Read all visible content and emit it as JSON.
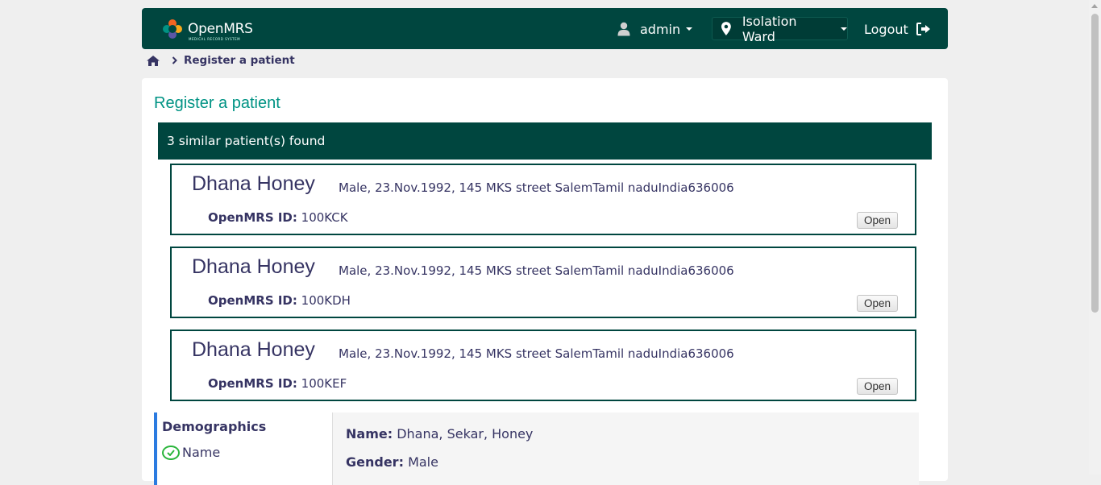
{
  "header": {
    "brand": "OpenMRS",
    "brand_sub": "MEDICAL RECORD SYSTEM",
    "user": "admin",
    "location": "Isolation Ward",
    "logout": "Logout",
    "bg_color": "#00463f"
  },
  "breadcrumb": {
    "current": "Register a patient"
  },
  "page": {
    "title": "Register a patient",
    "similar_count_text": "3 similar patient(s) found"
  },
  "matches": [
    {
      "name": "Dhana Honey",
      "info": "Male, 23.Nov.1992, 145 MKS street SalemTamil naduIndia636006",
      "id_label": "OpenMRS ID:",
      "id_value": "100KCK",
      "open_label": "Open"
    },
    {
      "name": "Dhana Honey",
      "info": "Male, 23.Nov.1992, 145 MKS street SalemTamil naduIndia636006",
      "id_label": "OpenMRS ID:",
      "id_value": "100KDH",
      "open_label": "Open"
    },
    {
      "name": "Dhana Honey",
      "info": "Male, 23.Nov.1992, 145 MKS street SalemTamil naduIndia636006",
      "id_label": "OpenMRS ID:",
      "id_value": "100KEF",
      "open_label": "Open"
    }
  ],
  "steps": {
    "section": "Demographics",
    "items": [
      {
        "label": "Name",
        "status": "complete"
      }
    ]
  },
  "summary": {
    "name_label": "Name:",
    "name_value": "Dhana, Sekar, Honey",
    "gender_label": "Gender:",
    "gender_value": "Male"
  }
}
